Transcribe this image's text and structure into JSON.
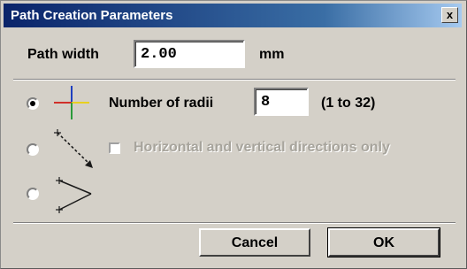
{
  "dialog": {
    "title": "Path Creation Parameters",
    "close_label": "x"
  },
  "path_width": {
    "label": "Path width",
    "value": "2.00",
    "unit": "mm"
  },
  "options": {
    "radii": {
      "label": "Number of radii",
      "value": "8",
      "range": "(1 to 32)",
      "selected": true,
      "icon": "crosshair-icon"
    },
    "diagonal": {
      "checkbox_label": "Horizontal and vertical directions only",
      "selected": false,
      "checkbox_checked": false,
      "icon": "diagonal-arrow-icon"
    },
    "angle": {
      "selected": false,
      "icon": "angle-paths-icon"
    }
  },
  "buttons": {
    "cancel": "Cancel",
    "ok": "OK"
  },
  "colors": {
    "title_bar": "#0a246a",
    "dialog_face": "#d4d0c8"
  }
}
